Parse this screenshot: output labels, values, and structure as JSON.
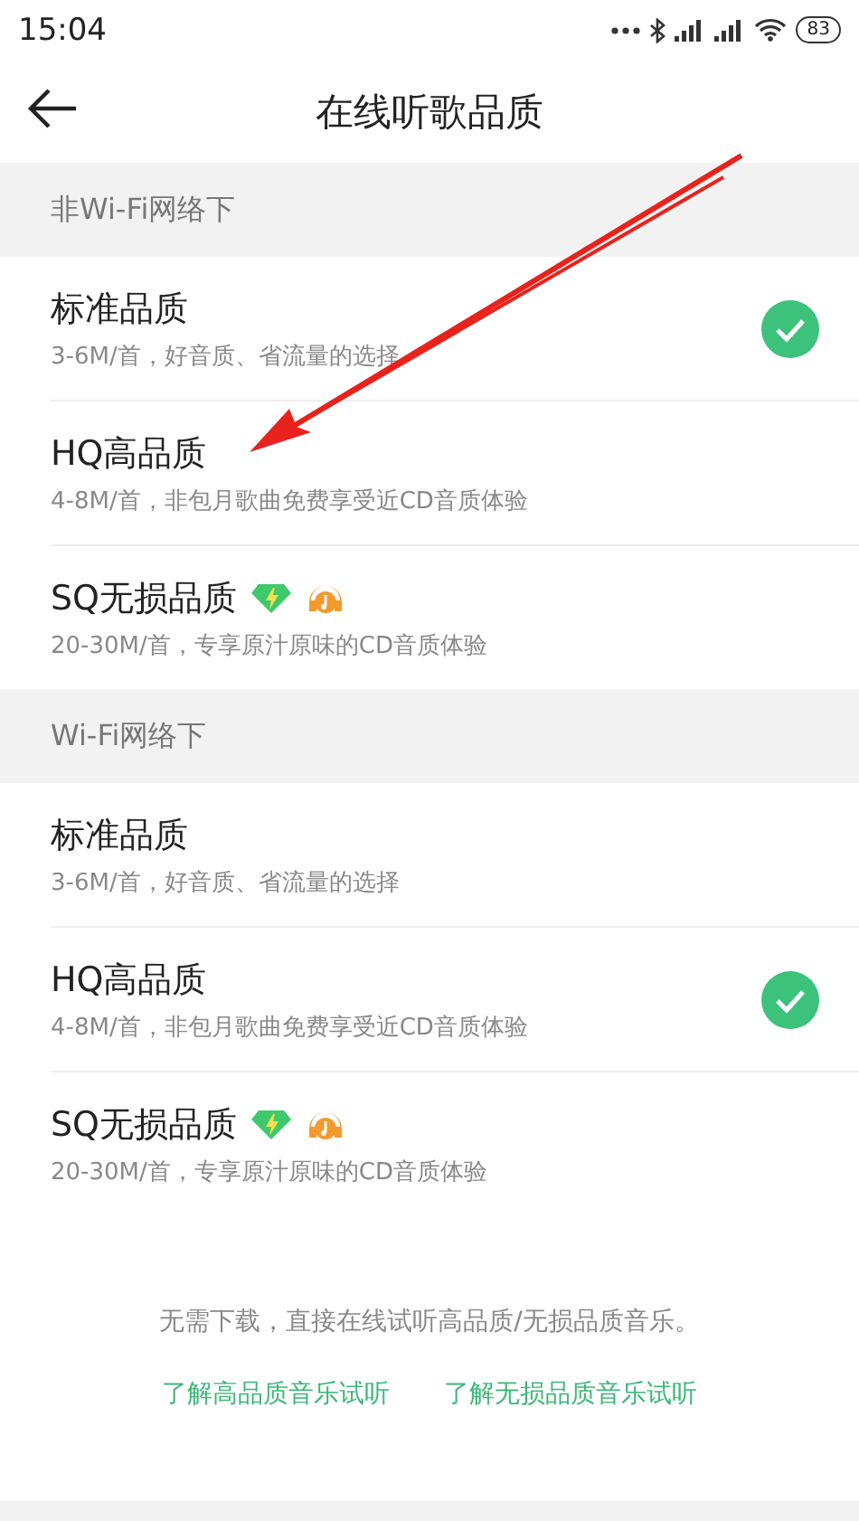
{
  "status_bar": {
    "time": "15:04",
    "battery": "83"
  },
  "header": {
    "title": "在线听歌品质"
  },
  "sections": [
    {
      "title": "非Wi-Fi网络下",
      "options": [
        {
          "name": "标准品质",
          "description": "3-6M/首，好音质、省流量的选择",
          "kind": "plain",
          "selected": true
        },
        {
          "name": "HQ高品质",
          "description": "4-8M/首，非包月歌曲免费享受近CD音质体验",
          "kind": "plain",
          "selected": false
        },
        {
          "name": "SQ无损品质",
          "description": "20-30M/首，专享原汁原味的CD音质体验",
          "kind": "lossless",
          "selected": false
        }
      ]
    },
    {
      "title": "Wi-Fi网络下",
      "options": [
        {
          "name": "标准品质",
          "description": "3-6M/首，好音质、省流量的选择",
          "kind": "plain",
          "selected": false
        },
        {
          "name": "HQ高品质",
          "description": "4-8M/首，非包月歌曲免费享受近CD音质体验",
          "kind": "plain",
          "selected": true
        },
        {
          "name": "SQ无损品质",
          "description": "20-30M/首，专享原汁原味的CD音质体验",
          "kind": "lossless",
          "selected": false
        }
      ]
    }
  ],
  "footer": {
    "note": "无需下载，直接在线试听高品质/无损品质音乐。",
    "links": [
      "了解高品质音乐试听",
      "了解无损品质音乐试听"
    ]
  }
}
